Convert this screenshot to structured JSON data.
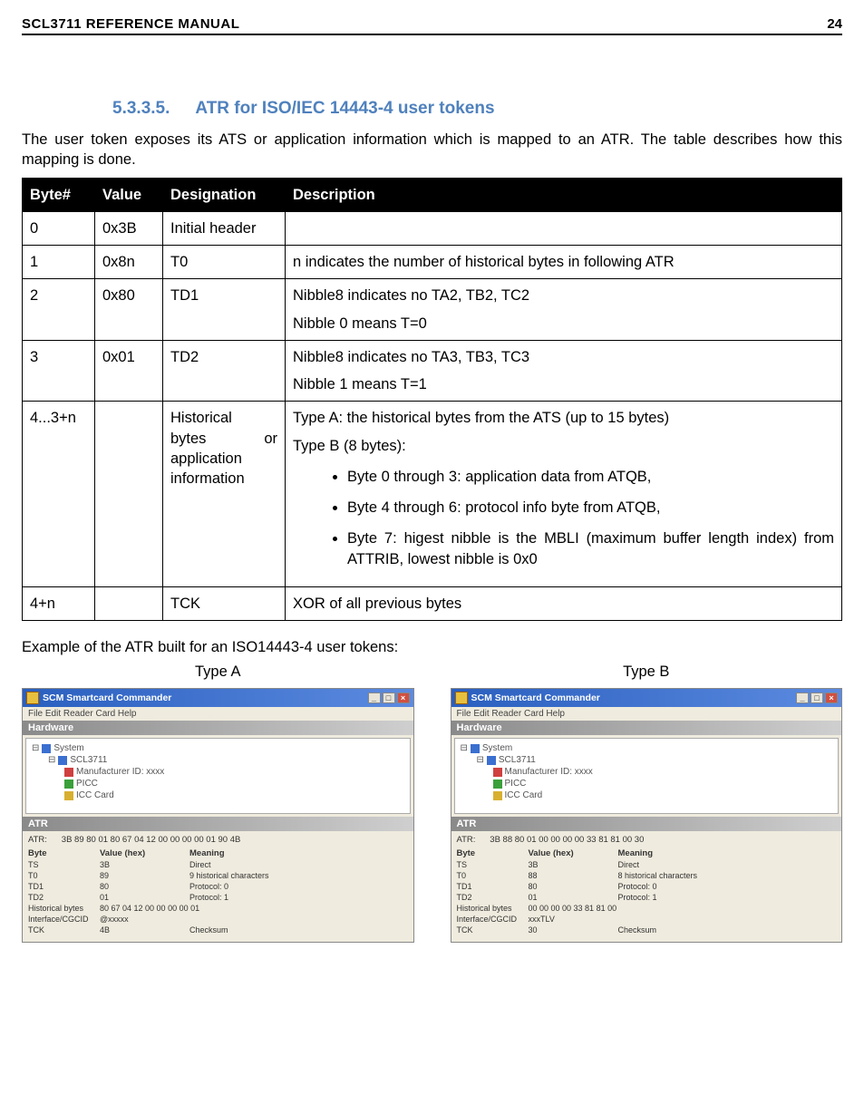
{
  "header": {
    "title": "SCL3711 REFERENCE MANUAL",
    "page": "24"
  },
  "section": {
    "number": "5.3.3.5.",
    "title": "ATR for ISO/IEC 14443-4 user tokens"
  },
  "intro": "The user token exposes its ATS or application information which is mapped to an ATR. The table describes how this mapping is done.",
  "table": {
    "headers": {
      "byte": "Byte#",
      "value": "Value",
      "designation": "Designation",
      "description": "Description"
    },
    "rows": [
      {
        "byte": "0",
        "value": "0x3B",
        "designation": "Initial header",
        "description": ""
      },
      {
        "byte": "1",
        "value": "0x8n",
        "designation": "T0",
        "description": "n indicates the number of historical bytes in following ATR"
      },
      {
        "byte": "2",
        "value": "0x80",
        "designation": "TD1",
        "desc1": "Nibble8 indicates no TA2, TB2, TC2",
        "desc2": "Nibble 0 means T=0"
      },
      {
        "byte": "3",
        "value": "0x01",
        "designation": "TD2",
        "desc1": "Nibble8 indicates no TA3, TB3, TC3",
        "desc2": "Nibble 1 means T=1"
      },
      {
        "byte": "4...3+n",
        "value": "",
        "desig_lines": [
          "Historical",
          "bytes",
          "or",
          "application",
          "information"
        ],
        "line_a": "Type A: the historical bytes from the ATS (up to 15 bytes)",
        "line_b": "Type B (8 bytes):",
        "bullets": [
          "Byte 0 through 3: application data from ATQB,",
          "Byte 4 through 6: protocol info byte from ATQB,",
          "Byte 7: higest nibble is the MBLI (maximum buffer length index) from ATTRIB, lowest nibble is 0x0"
        ]
      },
      {
        "byte": "4+n",
        "value": "",
        "designation": "TCK",
        "description": "XOR of all previous bytes"
      }
    ]
  },
  "example_label": "Example of the ATR built for an ISO14443-4 user tokens:",
  "columns": {
    "a": "Type A",
    "b": "Type B"
  },
  "windowA": {
    "title": "SCM Smartcard Commander",
    "menu": "File  Edit  Reader  Card  Help",
    "hardware": "Hardware",
    "tree": {
      "root": "System",
      "n1": "SCL3711",
      "n2": "Manufacturer ID: xxxx",
      "n3": "PICC",
      "n4": "ICC Card"
    },
    "atr_header": "ATR",
    "atr_label": "ATR:",
    "atr_value": "3B 89 80 01 80 67 04 12 00 00 00 00 01 90 4B",
    "cols": {
      "byte": "Byte",
      "value": "Value (hex)",
      "meaning": "Meaning"
    },
    "rows": [
      {
        "byte": "TS",
        "value": "3B",
        "meaning": "Direct"
      },
      {
        "byte": "T0",
        "value": "89",
        "meaning": "9 historical characters"
      },
      {
        "byte": "TD1",
        "value": "80",
        "meaning": "Protocol: 0"
      },
      {
        "byte": "TD2",
        "value": "01",
        "meaning": "Protocol: 1"
      },
      {
        "byte": "Historical bytes",
        "value": "80 67 04 12 00 00 00 00 01",
        "meaning": ""
      },
      {
        "byte": "Interface/CGCID",
        "value": "@xxxxx",
        "meaning": ""
      },
      {
        "byte": "TCK",
        "value": "4B",
        "meaning": "Checksum"
      }
    ]
  },
  "windowB": {
    "title": "SCM Smartcard Commander",
    "menu": "File  Edit  Reader  Card  Help",
    "hardware": "Hardware",
    "tree": {
      "root": "System",
      "n1": "SCL3711",
      "n2": "Manufacturer ID: xxxx",
      "n3": "PICC",
      "n4": "ICC Card"
    },
    "atr_header": "ATR",
    "atr_label": "ATR:",
    "atr_value": "3B 88 80 01 00 00 00 00 33 81 81 00 30",
    "cols": {
      "byte": "Byte",
      "value": "Value (hex)",
      "meaning": "Meaning"
    },
    "rows": [
      {
        "byte": "TS",
        "value": "3B",
        "meaning": "Direct"
      },
      {
        "byte": "T0",
        "value": "88",
        "meaning": "8 historical characters"
      },
      {
        "byte": "TD1",
        "value": "80",
        "meaning": "Protocol: 0"
      },
      {
        "byte": "TD2",
        "value": "01",
        "meaning": "Protocol: 1"
      },
      {
        "byte": "Historical bytes",
        "value": "00 00 00 00 33 81 81 00",
        "meaning": ""
      },
      {
        "byte": "Interface/CGCID",
        "value": "xxxTLV",
        "meaning": ""
      },
      {
        "byte": "TCK",
        "value": "30",
        "meaning": "Checksum"
      }
    ]
  }
}
